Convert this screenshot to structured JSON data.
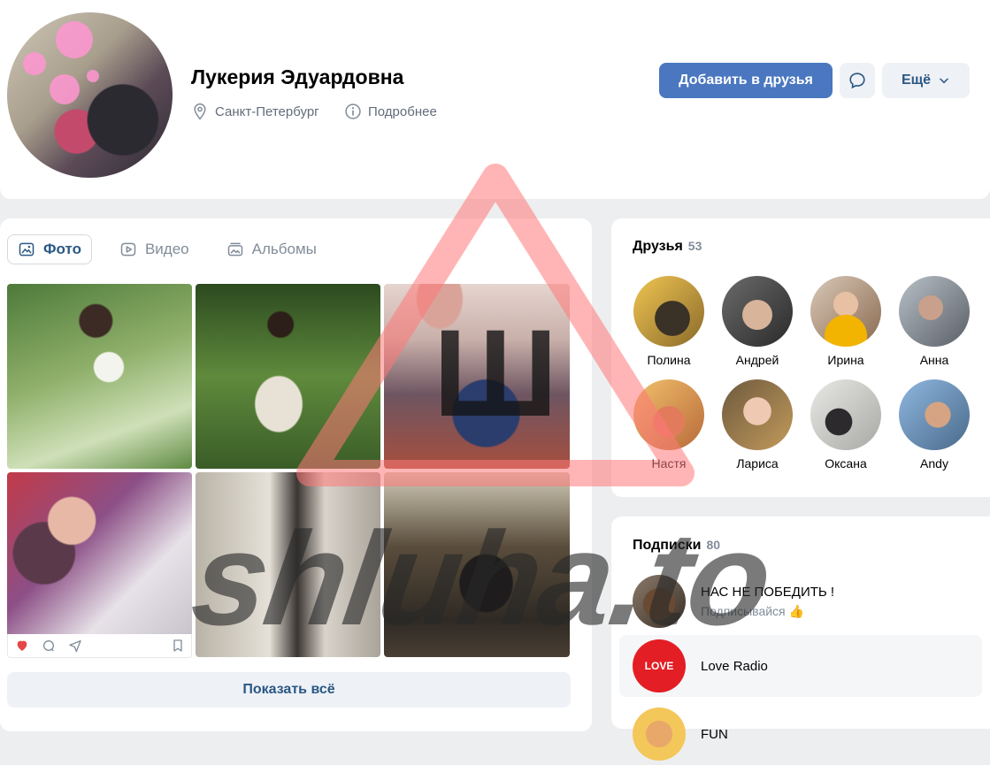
{
  "profile": {
    "name": "Лукерия Эдуардовна",
    "city": "Санкт-Петербург",
    "details_link": "Подробнее",
    "add_friend_label": "Добавить в друзья",
    "more_label": "Ещё"
  },
  "photos": {
    "tabs": [
      {
        "label": "Фото",
        "icon": "image-icon",
        "active": true
      },
      {
        "label": "Видео",
        "icon": "video-icon"
      },
      {
        "label": "Альбомы",
        "icon": "albums-icon"
      }
    ],
    "show_all_label": "Показать всё"
  },
  "friends": {
    "title": "Друзья",
    "count": "53",
    "items": [
      {
        "name": "Полина"
      },
      {
        "name": "Андрей"
      },
      {
        "name": "Ирина"
      },
      {
        "name": "Анна"
      },
      {
        "name": "Настя"
      },
      {
        "name": "Лариса"
      },
      {
        "name": "Оксана"
      },
      {
        "name": "Andy"
      }
    ]
  },
  "subscriptions": {
    "title": "Подписки",
    "count": "80",
    "items": [
      {
        "title": "НАС НЕ ПОБЕДИТЬ !",
        "subtitle": "Подписывайся 👍"
      },
      {
        "title": "Love Radio",
        "logo_text": "LOVE"
      },
      {
        "title": "FUN"
      }
    ]
  },
  "watermark": {
    "text": "shluha.to",
    "logo_letter": "Ш"
  },
  "colors": {
    "accent": "#4a77c0",
    "link": "#2a5885",
    "muted": "#818c99",
    "like": "#e64646"
  }
}
